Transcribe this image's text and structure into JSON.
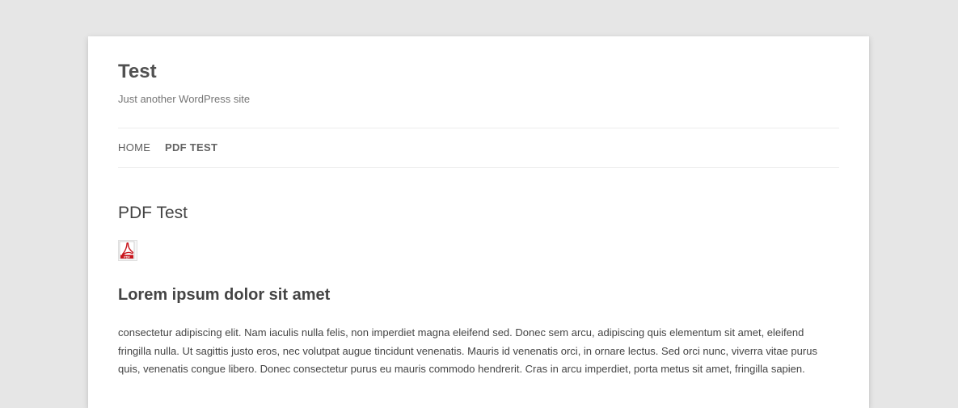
{
  "site": {
    "title": "Test",
    "description": "Just another WordPress site"
  },
  "nav": {
    "items": [
      {
        "label": "HOME",
        "current": false
      },
      {
        "label": "PDF TEST",
        "current": true
      }
    ]
  },
  "entry": {
    "title": "PDF Test",
    "attachment_icon": "pdf-file-icon",
    "heading": "Lorem ipsum dolor sit amet",
    "paragraph": "consectetur adipiscing elit. Nam iaculis nulla felis, non imperdiet magna eleifend sed. Donec sem arcu, adipiscing quis elementum sit amet, eleifend fringilla nulla. Ut sagittis justo eros, nec volutpat augue tincidunt venenatis. Mauris id venenatis orci, in ornare lectus. Sed orci nunc, viverra vitae purus quis, venenatis congue libero. Donec consectetur purus eu mauris commodo hendrerit. Cras in arcu imperdiet, porta metus sit amet, fringilla sapien."
  },
  "colors": {
    "background": "#e6e6e6",
    "page": "#ffffff",
    "text": "#444444",
    "pdf_red": "#c8161d"
  }
}
